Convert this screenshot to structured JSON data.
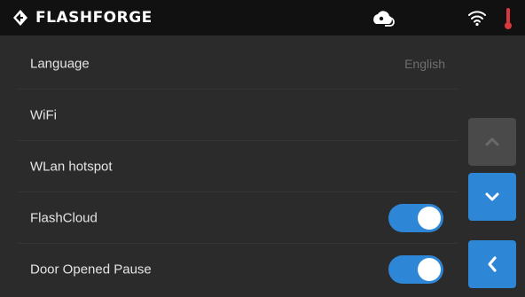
{
  "header": {
    "brand": "FLASHFORGE",
    "icons": {
      "logo": "flashforge-logo-icon",
      "cloud": "cloud-status-icon",
      "wifi": "wifi-icon",
      "temperature": "thermometer-icon"
    }
  },
  "settings": [
    {
      "label": "Language",
      "value": "English"
    },
    {
      "label": "WiFi"
    },
    {
      "label": "WLan hotspot"
    },
    {
      "label": "FlashCloud",
      "toggle": true
    },
    {
      "label": "Door Opened Pause",
      "toggle": true
    }
  ],
  "side_buttons": {
    "up": "chevron-up-icon",
    "down": "chevron-down-icon",
    "back": "chevron-left-icon"
  },
  "colors": {
    "accent": "#2d86d6",
    "background": "#2b2b2b",
    "topbar": "#111111",
    "temp_indicator": "#d9383c",
    "disabled_button": "#4a4a4a"
  }
}
